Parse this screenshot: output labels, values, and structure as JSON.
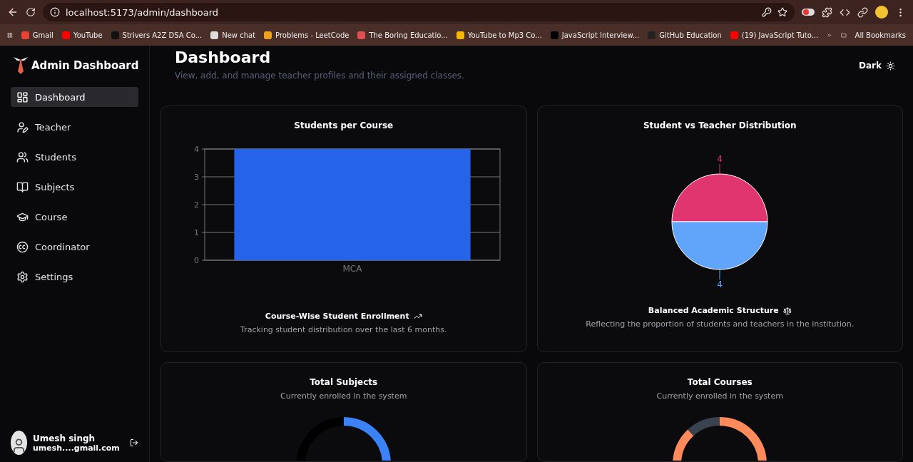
{
  "browser": {
    "url": "localhost:5173/admin/dashboard",
    "bookmarks": [
      {
        "label": "Gmail",
        "color": "#ea4335"
      },
      {
        "label": "YouTube",
        "color": "#ff0000"
      },
      {
        "label": "Strivers A2Z DSA Co...",
        "color": "#111111"
      },
      {
        "label": "New chat",
        "color": "#dddddd"
      },
      {
        "label": "Problems - LeetCode",
        "color": "#f0a020"
      },
      {
        "label": "The Boring Educatio...",
        "color": "#e05050"
      },
      {
        "label": "YouTube to Mp3 Co...",
        "color": "#f5b800"
      },
      {
        "label": "JavaScript Interview...",
        "color": "#000000"
      },
      {
        "label": "GitHub Education",
        "color": "#222222"
      },
      {
        "label": "(19) JavaScript Tuto...",
        "color": "#ff0000"
      }
    ],
    "all_bookmarks": "All Bookmarks"
  },
  "sidebar": {
    "brand": "Admin Dashboard",
    "items": [
      {
        "kind": "dashboard",
        "label": "Dashboard",
        "selected": true
      },
      {
        "kind": "teacher",
        "label": "Teacher",
        "selected": false
      },
      {
        "kind": "students",
        "label": "Students",
        "selected": false
      },
      {
        "kind": "subjects",
        "label": "Subjects",
        "selected": false
      },
      {
        "kind": "course",
        "label": "Course",
        "selected": false
      },
      {
        "kind": "coordinator",
        "label": "Coordinator",
        "selected": false
      },
      {
        "kind": "settings",
        "label": "Settings",
        "selected": false
      }
    ],
    "user": {
      "name": "Umesh singh",
      "email": "umesh....gmail.com"
    }
  },
  "header": {
    "title": "Dashboard",
    "subtitle": "View, add, and manage teacher profiles and their assigned classes.",
    "theme_button": "Dark"
  },
  "cards": [
    {
      "kind": "bar",
      "footer_title": "Course-Wise Student Enrollment",
      "footer_text": "Tracking student distribution over the last 6 months.",
      "chart_data": {
        "type": "bar",
        "title": "Students per Course",
        "categories": [
          "MCA"
        ],
        "values": [
          4
        ],
        "ylim": [
          0,
          4
        ],
        "yticks": [
          0,
          1,
          2,
          3,
          4
        ],
        "grid": true
      }
    },
    {
      "kind": "pie",
      "footer_title": "Balanced Academic Structure",
      "footer_text": "Reflecting the proportion of students and teachers in the institution.",
      "slice_colors": [
        {
          "color": "#e0356f"
        },
        {
          "color": "#60a5fa"
        }
      ],
      "chart_data": {
        "type": "pie",
        "title": "Student vs Teacher Distribution",
        "values": [
          4,
          4
        ],
        "data_labels": true
      }
    },
    {
      "kind": "donut",
      "title": "Total Subjects",
      "subtitle": "Currently enrolled in the system",
      "segments": [
        {
          "color": "#3b82f6"
        },
        {
          "color": "#000000"
        }
      ]
    },
    {
      "kind": "donut",
      "title": "Total Courses",
      "subtitle": "Currently enrolled in the system",
      "segments": [
        {
          "color": "#ff8a5c"
        },
        {
          "color": "#3a4250"
        }
      ]
    }
  ]
}
